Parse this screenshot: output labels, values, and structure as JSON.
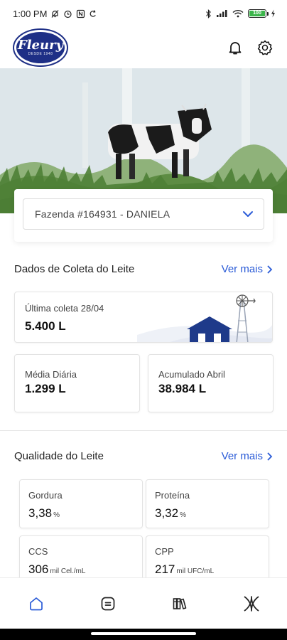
{
  "status_bar": {
    "time": "1:00 PM",
    "battery_label": "100",
    "icons": [
      "muted-icon",
      "alarm-icon",
      "nfc-icon",
      "sync-icon",
      "bluetooth-icon",
      "signal-icon",
      "wifi-icon",
      "battery-icon",
      "charging-icon"
    ]
  },
  "header": {
    "logo_text": "Fleury",
    "logo_tagline": "DESDE 1948",
    "icons": [
      "bell-icon",
      "gear-icon"
    ]
  },
  "farm_selector": {
    "value": "Fazenda #164931 - DANIELA"
  },
  "milk_collection": {
    "title": "Dados de Coleta do Leite",
    "see_more": "Ver mais",
    "last_collection": {
      "label": "Última coleta 28/04",
      "value": "5.400 L"
    },
    "daily_average": {
      "label": "Média Diária",
      "value": "1.299 L"
    },
    "accumulated": {
      "label": "Acumulado Abril",
      "value": "38.984 L"
    }
  },
  "milk_quality": {
    "title": "Qualidade do Leite",
    "see_more": "Ver mais",
    "items": [
      {
        "label": "Gordura",
        "value": "3,38",
        "unit": "%"
      },
      {
        "label": "Proteína",
        "value": "3,32",
        "unit": "%"
      },
      {
        "label": "CCS",
        "value": "306",
        "unit": "mil Cel./mL"
      },
      {
        "label": "CPP",
        "value": "217",
        "unit": "mil UFC/mL"
      }
    ]
  },
  "bottom_nav": [
    "home-icon",
    "statement-icon",
    "library-icon",
    "fleury-icon"
  ],
  "colors": {
    "accent": "#2a5bd7",
    "brand": "#1e2f86",
    "battery": "#3bb54a"
  }
}
